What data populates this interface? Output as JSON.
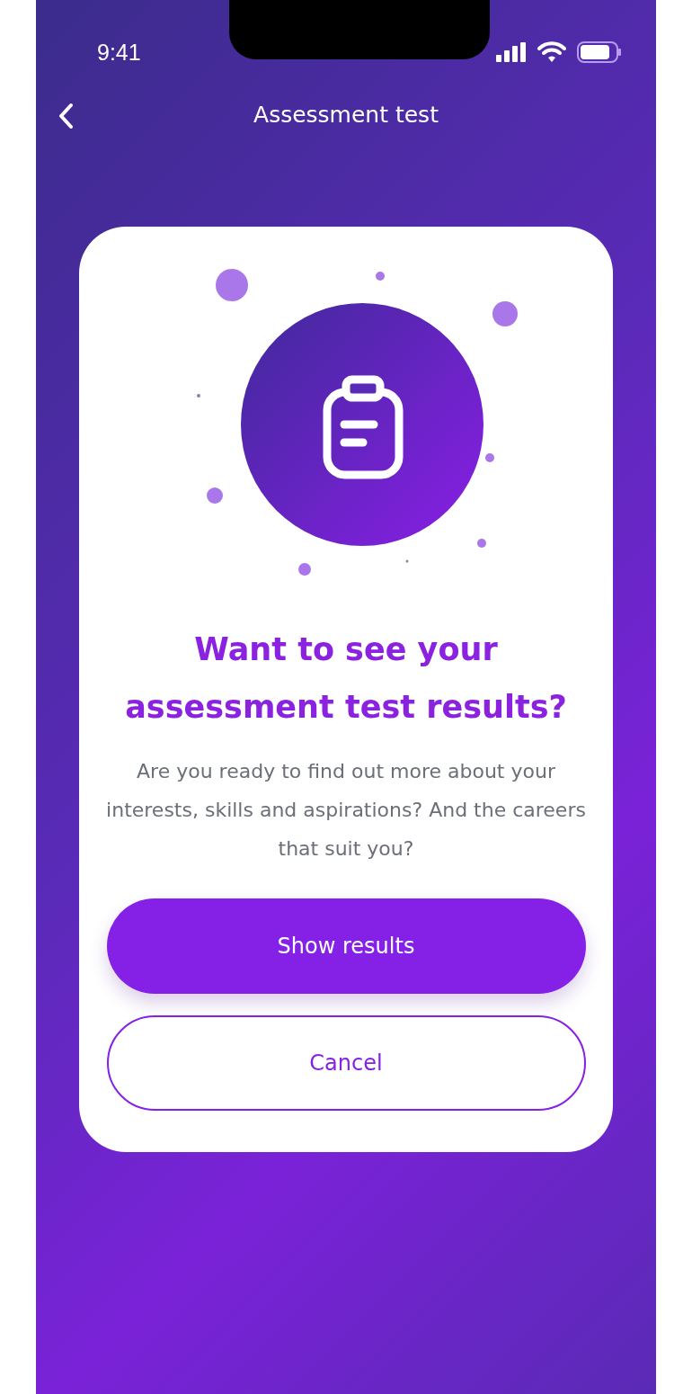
{
  "status_bar": {
    "time": "9:41"
  },
  "nav": {
    "title": "Assessment test"
  },
  "dialog": {
    "title": "Want to see your assessment test results?",
    "message": "Are you ready to find out more about your interests, skills and aspirations? And the careers that suit you?",
    "buttons": [
      {
        "label": "Show results",
        "kind": "primary"
      },
      {
        "label": "Cancel",
        "kind": "outline"
      }
    ]
  }
}
